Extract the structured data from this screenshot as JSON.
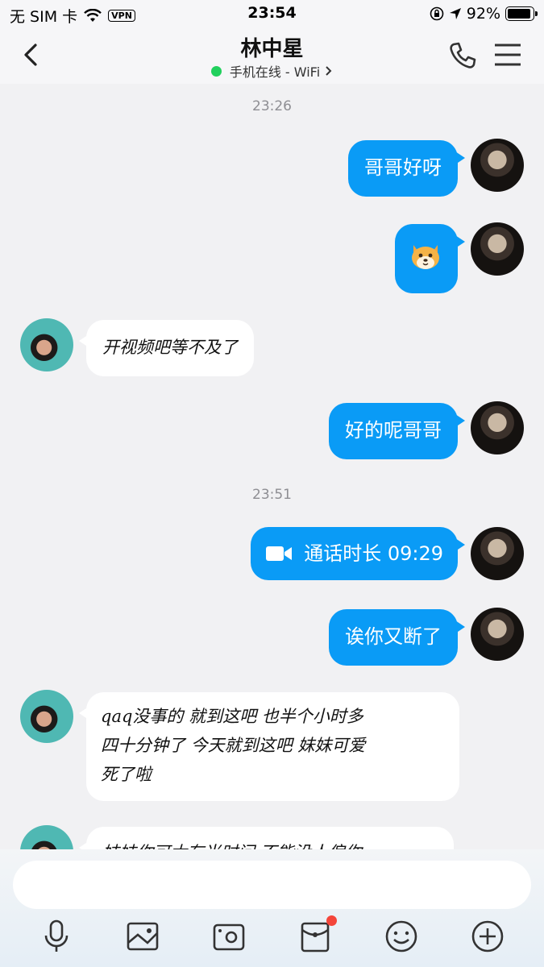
{
  "status_bar": {
    "carrier": "无 SIM 卡",
    "vpn": "VPN",
    "time": "23:54",
    "battery": "92%",
    "battery_level": 0.92
  },
  "header": {
    "title": "林中星",
    "subtitle": "手机在线 - WiFi",
    "online_color": "#21d05d"
  },
  "messages": [
    {
      "type": "timestamp",
      "text": "23:26"
    },
    {
      "type": "out",
      "text": "哥哥好呀"
    },
    {
      "type": "out-sticker",
      "icon": "shiba-dog-sticker"
    },
    {
      "type": "in",
      "text": "开视频吧等不及了"
    },
    {
      "type": "out",
      "text": "好的呢哥哥"
    },
    {
      "type": "timestamp",
      "text": "23:51"
    },
    {
      "type": "out-call",
      "text": "通话时长 09:29",
      "icon": "video-camera-icon"
    },
    {
      "type": "out",
      "text": "诶你又断了"
    },
    {
      "type": "in",
      "lines": [
        "qaq没事的 就到这吧 也半个小时多",
        "四十分钟了 今天就到这吧 妹妹可爱",
        "死了啦"
      ]
    },
    {
      "type": "in",
      "text": "妹妹你可太有当时问 不能没人偏你"
    }
  ],
  "input": {
    "placeholder": ""
  },
  "toolbar": {
    "icons": [
      "microphone-icon",
      "image-icon",
      "camera-icon",
      "red-packet-icon",
      "emoji-icon",
      "plus-icon"
    ]
  },
  "colors": {
    "bubble_out": "#0a9bf6",
    "bubble_in": "#ffffff",
    "background": "#f1f1f3"
  }
}
